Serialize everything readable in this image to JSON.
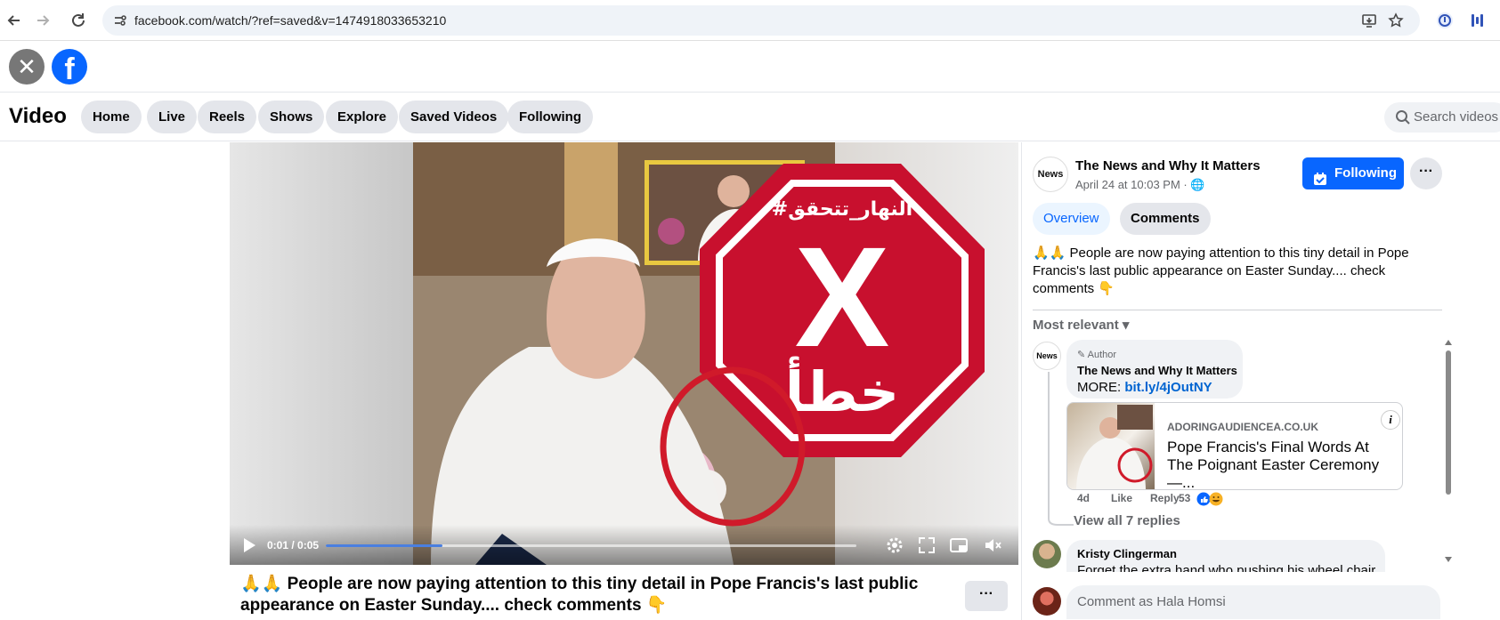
{
  "browser": {
    "url": "facebook.com/watch/?ref=saved&v=1474918033653210",
    "icons": [
      "back-arrow-icon",
      "forward-arrow-icon",
      "reload-icon",
      "site-info-icon",
      "install-app-icon",
      "star-icon",
      "extension-icon",
      "sidebar-icon"
    ]
  },
  "fb": {
    "logo_letter": "f",
    "close_glyph": "✕"
  },
  "videobar": {
    "title": "Video",
    "tabs": [
      "Home",
      "Live",
      "Reels",
      "Shows",
      "Explore",
      "Saved Videos",
      "Following"
    ],
    "search_placeholder": "Search videos"
  },
  "video": {
    "overlay_hashtag": "#النهار_تتحقق",
    "overlay_mark": "X",
    "overlay_word": "خطأ",
    "time": "0:01 / 0:05",
    "progress": 0.22,
    "title": "🙏🙏 People are now paying attention to this tiny detail in Pope Francis's last public appearance on Easter Sunday.... check comments 👇",
    "more_label": "···"
  },
  "panel": {
    "page_avatar": "News",
    "page_name": "The News and Why It Matters",
    "date": "April 24 at 10:03 PM · 🌐",
    "follow_label": "Following",
    "dots": "···",
    "tabs": [
      "Overview",
      "Comments"
    ],
    "description": "🙏🙏 People are now paying attention to this tiny detail in Pope Francis's last public appearance on Easter Sunday.... check comments 👇",
    "sort_label": "Most relevant ▾",
    "comment1": {
      "badge": "✎ Author",
      "name": "The News and Why It Matters",
      "text_prefix": "MORE: ",
      "link": "bit.ly/4jOutNY"
    },
    "link_card": {
      "domain": "ADORINGAUDIENCEA.CO.UK",
      "title": "Pope Francis's Final Words At The Poignant Easter Ceremony —...",
      "info": "i"
    },
    "comment1_actions": {
      "age": "4d",
      "like": "Like",
      "reply": "Reply",
      "reactions": "53"
    },
    "view_replies": "View all 7 replies",
    "comment2": {
      "name": "Kristy Clingerman",
      "text": "Forget the extra hand who pushing his wheel chair"
    },
    "compose_placeholder": "Comment as Hala Homsi"
  },
  "colors": {
    "fb_blue": "#0866ff",
    "pill_bg": "#e4e6eb",
    "stop_red": "#c8102e"
  }
}
